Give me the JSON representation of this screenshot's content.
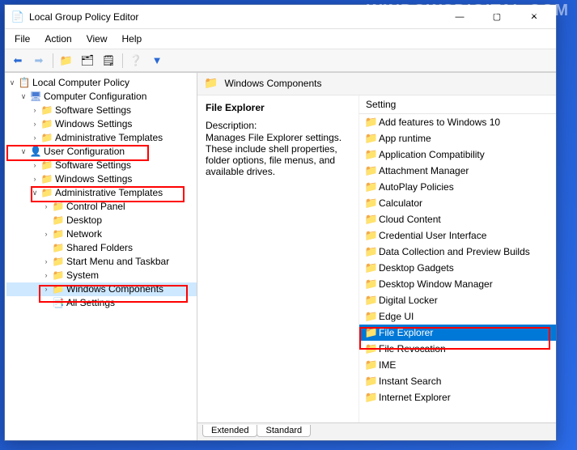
{
  "watermark": "WINDOWSDIGITAL.COM",
  "titlebar": {
    "title": "Local Group Policy Editor"
  },
  "menubar": {
    "file": "File",
    "action": "Action",
    "view": "View",
    "help": "Help"
  },
  "tree": {
    "root": "Local Computer Policy",
    "computer_config": "Computer Configuration",
    "cc_software": "Software Settings",
    "cc_windows": "Windows Settings",
    "cc_admin": "Administrative Templates",
    "user_config": "User Configuration",
    "uc_software": "Software Settings",
    "uc_windows": "Windows Settings",
    "uc_admin": "Administrative Templates",
    "uc_admin_children": {
      "control_panel": "Control Panel",
      "desktop": "Desktop",
      "network": "Network",
      "shared_folders": "Shared Folders",
      "start_menu": "Start Menu and Taskbar",
      "system": "System",
      "windows_components": "Windows Components",
      "all_settings": "All Settings"
    }
  },
  "detail": {
    "header": "Windows Components",
    "selected_name": "File Explorer",
    "desc_label": "Description:",
    "desc_text": "Manages File Explorer settings. These include shell properties, folder options, file menus, and available drives.",
    "column_header": "Setting",
    "items": [
      "Add features to Windows 10",
      "App runtime",
      "Application Compatibility",
      "Attachment Manager",
      "AutoPlay Policies",
      "Calculator",
      "Cloud Content",
      "Credential User Interface",
      "Data Collection and Preview Builds",
      "Desktop Gadgets",
      "Desktop Window Manager",
      "Digital Locker",
      "Edge UI",
      "File Explorer",
      "File Revocation",
      "IME",
      "Instant Search",
      "Internet Explorer"
    ]
  },
  "tabs": {
    "extended": "Extended",
    "standard": "Standard"
  }
}
